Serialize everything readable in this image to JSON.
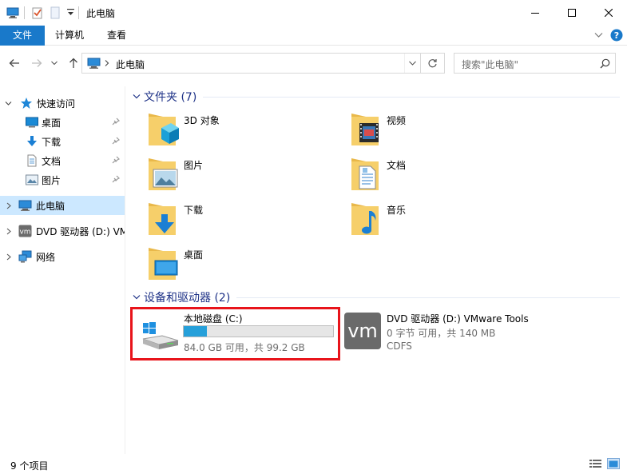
{
  "window": {
    "title": "此电脑"
  },
  "ribbon": {
    "tabs": [
      "文件",
      "计算机",
      "查看"
    ]
  },
  "address": {
    "path": "此电脑",
    "search_placeholder": "搜索\"此电脑\""
  },
  "nav": {
    "quick_access": "快速访问",
    "quick_items": [
      "桌面",
      "下载",
      "文档",
      "图片"
    ],
    "this_pc": "此电脑",
    "dvd": "DVD 驱动器 (D:) VMware Tools",
    "network": "网络"
  },
  "content": {
    "folders_header": "文件夹 (7)",
    "folders": [
      {
        "label": "3D 对象",
        "icon": "3d-objects-folder-icon"
      },
      {
        "label": "视频",
        "icon": "videos-folder-icon"
      },
      {
        "label": "图片",
        "icon": "pictures-folder-icon"
      },
      {
        "label": "文档",
        "icon": "documents-folder-icon"
      },
      {
        "label": "下载",
        "icon": "downloads-folder-icon"
      },
      {
        "label": "音乐",
        "icon": "music-folder-icon"
      },
      {
        "label": "桌面",
        "icon": "desktop-folder-icon"
      }
    ],
    "drives_header": "设备和驱动器 (2)",
    "drives": [
      {
        "name": "本地磁盘 (C:)",
        "free": "84.0 GB 可用，共 99.2 GB",
        "used_fraction": 0.153
      },
      {
        "name": "DVD 驱动器 (D:) VMware Tools",
        "free": "0 字节 可用，共 140 MB",
        "fs": "CDFS"
      }
    ]
  },
  "status": {
    "count": "9 个项目"
  },
  "colors": {
    "accent": "#1979ca",
    "group_header": "#1e3287",
    "selection": "#cce8ff",
    "highlight": "#e8141b",
    "bar_fill": "#26a0da"
  }
}
